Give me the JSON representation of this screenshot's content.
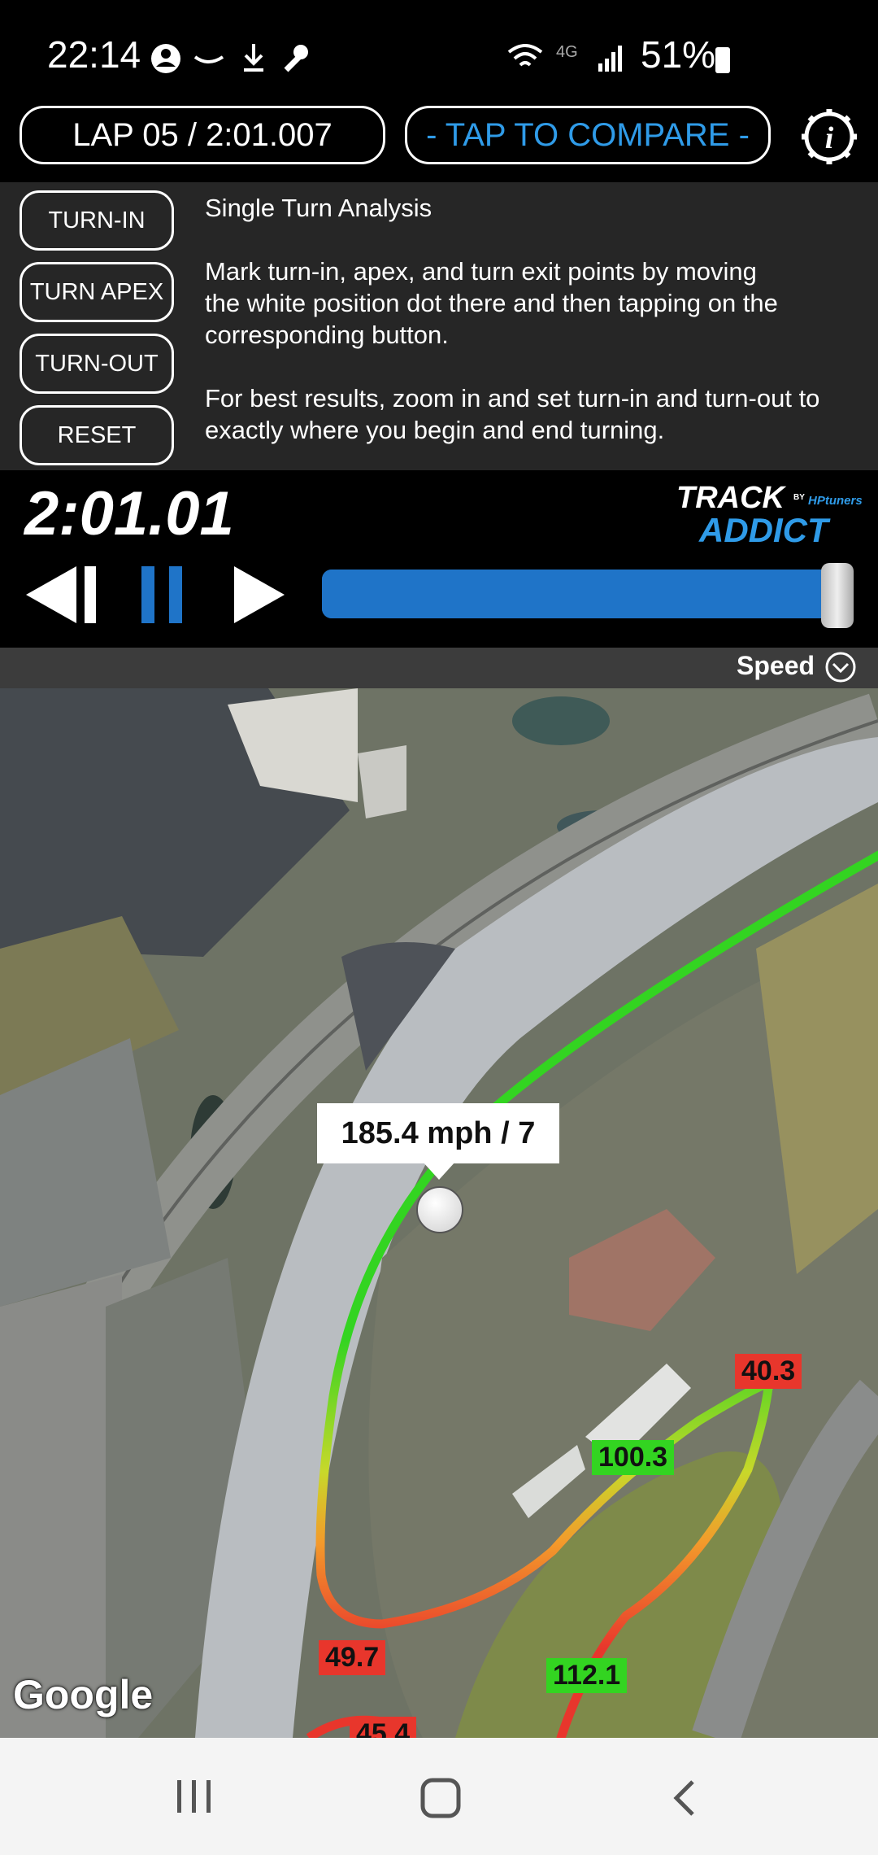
{
  "status_bar": {
    "time": "22:14",
    "network": "4G",
    "battery": "51%"
  },
  "top_bar": {
    "lap_selector": "LAP 05 / 2:01.007",
    "compare_button": "- TAP TO COMPARE -",
    "settings_icon": "gear-info-icon"
  },
  "turn_controls": {
    "turn_in": "TURN-IN",
    "turn_apex": "TURN APEX",
    "turn_out": "TURN-OUT",
    "reset": "RESET"
  },
  "info": {
    "title": "Single Turn Analysis",
    "line1": "Mark turn-in, apex, and turn exit points by moving",
    "line2": "the white position dot there and then tapping on the",
    "line3": "corresponding button.",
    "line4": "For best results, zoom in and set turn-in and turn-out to",
    "line5": "exactly where you begin and end turning."
  },
  "playback": {
    "elapsed": "2:01.01",
    "progress": 1.0,
    "logo_top": "TRACK",
    "logo_bottom": "ADDICT",
    "logo_by": "BY",
    "logo_brand": "HPtuners"
  },
  "data_selector": {
    "label": "Speed"
  },
  "map": {
    "tooltip": "185.4 mph / 7",
    "speed_labels": [
      "40.3",
      "100.3",
      "49.7",
      "112.1",
      "45.4"
    ],
    "attribution": "Google"
  },
  "colors": {
    "accent_blue": "#1f74c8",
    "compare_text": "#2f9be8",
    "fast": "#33d421",
    "slow": "#e8362c"
  }
}
